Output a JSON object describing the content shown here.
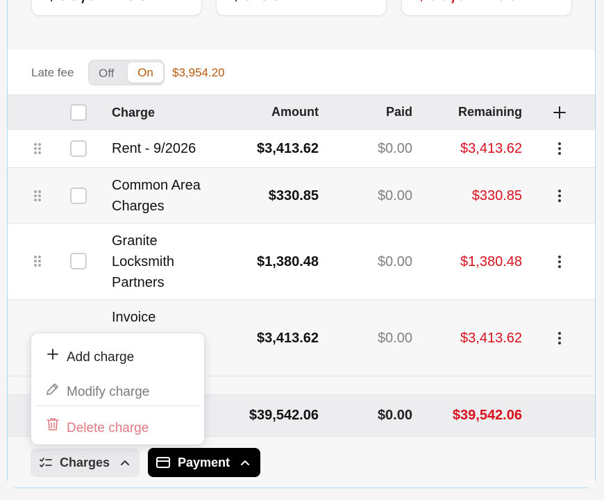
{
  "summary": {
    "total": "$39,542.06",
    "paid": "$0.00",
    "remaining": "$39,542.06"
  },
  "late_fee": {
    "label": "Late fee",
    "off_label": "Off",
    "on_label": "On",
    "selected": "On",
    "amount": "$3,954.20"
  },
  "table": {
    "headers": {
      "charge": "Charge",
      "amount": "Amount",
      "paid": "Paid",
      "remaining": "Remaining"
    },
    "rows": [
      {
        "charge": "Rent - 9/2026",
        "amount": "$3,413.62",
        "paid": "$0.00",
        "remaining": "$3,413.62"
      },
      {
        "charge": "Common Area Charges",
        "amount": "$330.85",
        "paid": "$0.00",
        "remaining": "$330.85"
      },
      {
        "charge": "Granite Locksmith Partners",
        "amount": "$1,380.48",
        "paid": "$0.00",
        "remaining": "$1,380.48"
      },
      {
        "charge": "Invoice",
        "amount": "$3,413.62",
        "paid": "$0.00",
        "remaining": "$3,413.62"
      }
    ],
    "totals": {
      "amount": "$39,542.06",
      "paid": "$0.00",
      "remaining": "$39,542.06"
    }
  },
  "charges_menu": {
    "items": [
      {
        "label": "Add charge",
        "icon": "plus-icon"
      },
      {
        "label": "Modify charge",
        "icon": "pencil-icon"
      },
      {
        "label": "Delete charge",
        "icon": "trash-icon"
      }
    ]
  },
  "toolbar": {
    "charges_label": "Charges",
    "payment_label": "Payment"
  },
  "colors": {
    "accent_red": "#d90f1c",
    "late_fee_orange": "#b85a09",
    "panel_border": "#a9dcf2"
  }
}
